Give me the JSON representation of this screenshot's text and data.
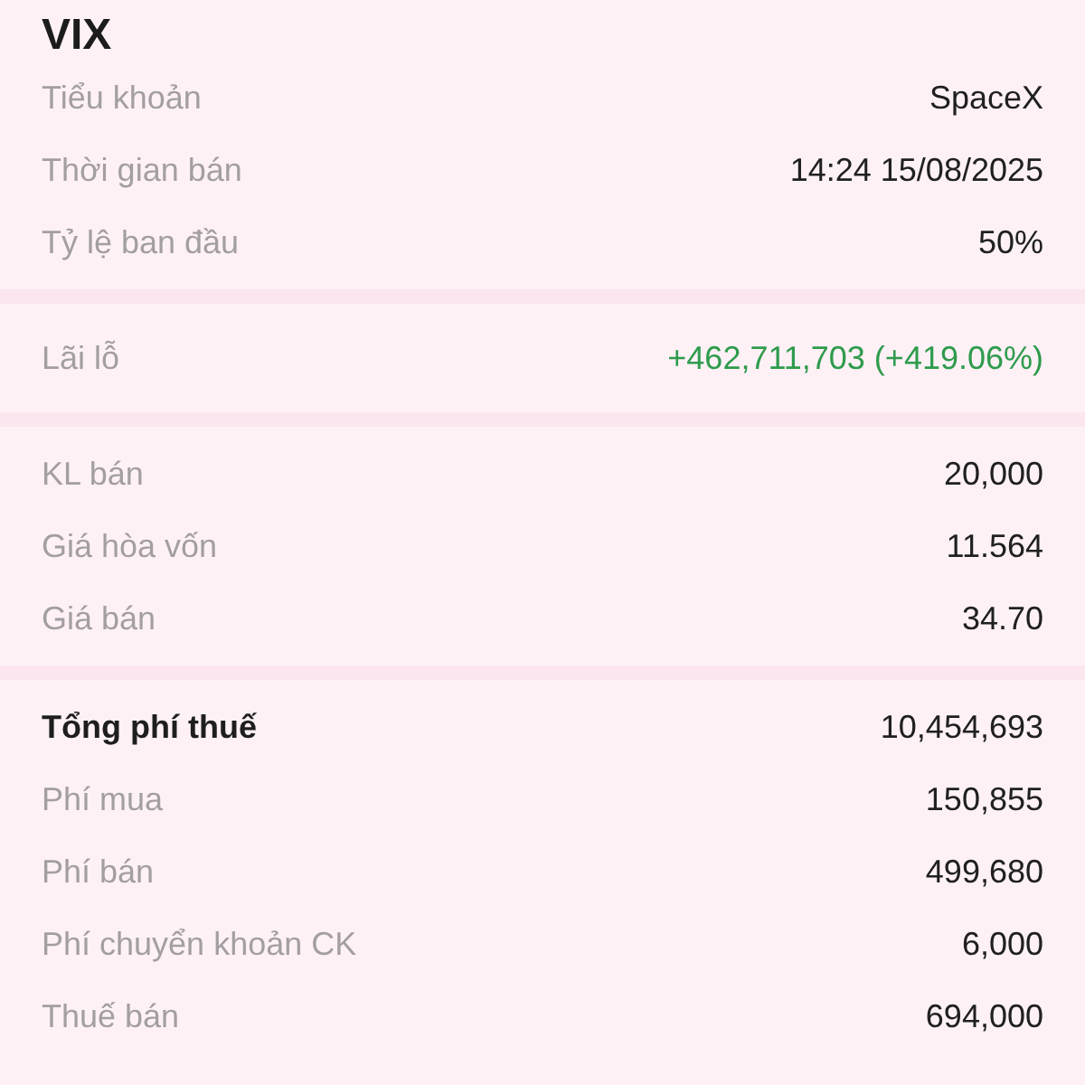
{
  "title": "VIX",
  "sections": [
    {
      "rows": [
        {
          "label": "Tiểu khoản",
          "value": "SpaceX"
        },
        {
          "label": "Thời gian bán",
          "value": "14:24 15/08/2025"
        },
        {
          "label": "Tỷ lệ ban đầu",
          "value": "50%"
        }
      ]
    },
    {
      "rows": [
        {
          "label": "Lãi lỗ",
          "value": "+462,711,703 (+419.06%)",
          "color": "#2e9b4c"
        }
      ]
    },
    {
      "rows": [
        {
          "label": "KL bán",
          "value": "20,000"
        },
        {
          "label": "Giá hòa vốn",
          "value": "11.564"
        },
        {
          "label": "Giá bán",
          "value": "34.70"
        }
      ]
    },
    {
      "rows": [
        {
          "label": "Tổng phí thuế",
          "value": "10,454,693",
          "kind": "total"
        },
        {
          "label": "Phí mua",
          "value": "150,855",
          "kind": "item"
        },
        {
          "label": "Phí bán",
          "value": "499,680",
          "kind": "item"
        },
        {
          "label": "Phí chuyển khoản CK",
          "value": "6,000",
          "kind": "item"
        },
        {
          "label": "Thuế bán",
          "value": "694,000",
          "kind": "item"
        }
      ]
    }
  ]
}
